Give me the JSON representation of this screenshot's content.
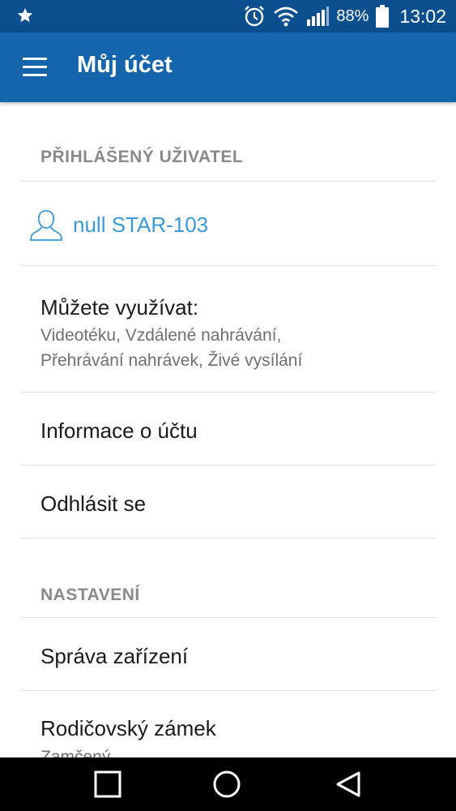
{
  "status_bar": {
    "notification_icon": "star-icon",
    "icons": [
      "alarm-icon",
      "wifi-icon",
      "signal-icon",
      "battery-icon"
    ],
    "battery_percent": "88%",
    "time": "13:02"
  },
  "app_bar": {
    "menu_icon": "hamburger-menu-icon",
    "title": "Můj účet"
  },
  "sections": {
    "logged_user": {
      "header": "PŘIHLÁŠENÝ UŽIVATEL",
      "user_icon": "user-icon",
      "user_name": "null STAR-103"
    },
    "features": {
      "title": "Můžete využívat:",
      "line1": "Videotéku, Vzdálené nahrávání,",
      "line2": "Přehrávání nahrávek, Živé vysílání"
    },
    "account_info": {
      "label": "Informace o účtu"
    },
    "logout": {
      "label": "Odhlásit se"
    },
    "settings": {
      "header": "NASTAVENÍ",
      "device_management": "Správa zařízení",
      "parental_lock": "Rodičovský zámek",
      "parental_lock_status": "Zamčený"
    }
  },
  "nav_bar": {
    "buttons": [
      "recent-apps-icon",
      "home-icon",
      "back-icon"
    ]
  },
  "colors": {
    "status_bar": "#0b4f8f",
    "app_bar": "#1565ad",
    "accent": "#3a9ad9",
    "section_header": "#8a8a8a"
  }
}
